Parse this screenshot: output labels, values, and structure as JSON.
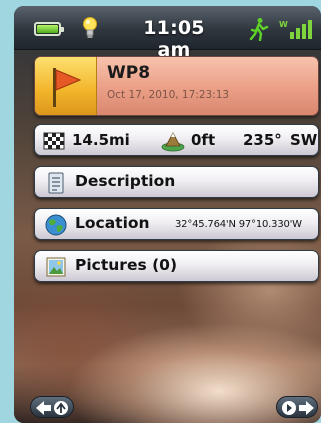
{
  "status_bar": {
    "time": "11:05 am",
    "battery_level": 1.0,
    "icons": [
      "battery-icon",
      "lightbulb-icon",
      "hiker-icon",
      "signal-strength-icon"
    ]
  },
  "waypoint": {
    "name": "WP8",
    "date": "Oct 17, 2010, 17:23:13",
    "icon": "flag-icon"
  },
  "stats": {
    "distance": "14.5mi",
    "elevation": "0ft",
    "bearing": "235°",
    "direction": "SW",
    "icons": [
      "checkered-flag-icon",
      "elevation-icon"
    ]
  },
  "rows": {
    "description_label": "Description",
    "location_label": "Location",
    "location_coords": "32°45.764'N 97°10.330'W",
    "pictures_label": "Pictures (0)"
  },
  "nav": {
    "back_icon": "back-arrow-icon",
    "next_icon": "next-arrow-icon"
  },
  "colors": {
    "title_card": "#ea9f86",
    "flag_box": "#f3b62c",
    "row_bg": "#f0eef2",
    "status_bar": "#2f363e"
  }
}
